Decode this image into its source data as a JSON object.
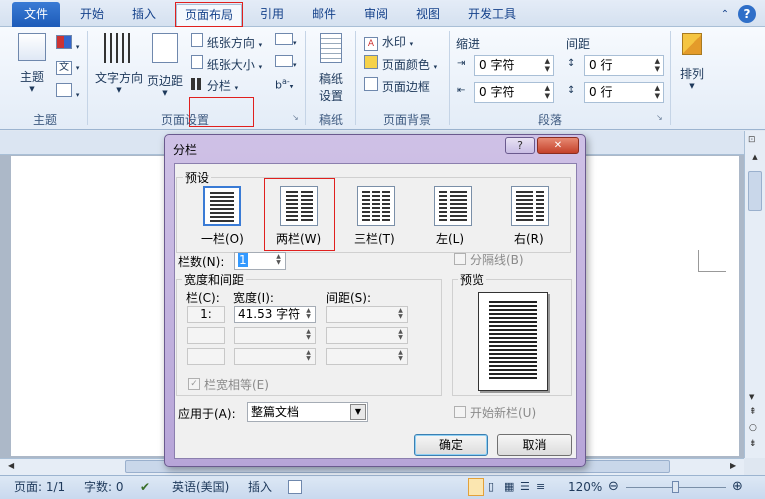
{
  "tabs": [
    "文件",
    "开始",
    "插入",
    "页面布局",
    "引用",
    "邮件",
    "审阅",
    "视图",
    "开发工具"
  ],
  "ribbon": {
    "theme_group": {
      "label": "主题",
      "theme_btn": "主题"
    },
    "page_setup_group": {
      "label": "页面设置",
      "text_direction": "文字方向",
      "margins": "页边距",
      "orientation": "纸张方向",
      "size": "纸张大小",
      "columns": "分栏"
    },
    "draft_group": {
      "label": "稿纸",
      "draft_btn_line1": "稿纸",
      "draft_btn_line2": "设置"
    },
    "background_group": {
      "label": "页面背景",
      "watermark": "水印",
      "page_color": "页面颜色",
      "page_borders": "页面边框"
    },
    "paragraph_group": {
      "label": "段落",
      "indent_label": "缩进",
      "spacing_label": "间距",
      "indent_left": "0 字符",
      "indent_right": "0 字符",
      "spacing_before": "0 行",
      "spacing_after": "0 行"
    },
    "arrange_group": {
      "label": "排列"
    }
  },
  "dialog": {
    "title": "分栏",
    "help": "?",
    "close": "✕",
    "preset_label": "预设",
    "presets": [
      "一栏(O)",
      "两栏(W)",
      "三栏(T)",
      "左(L)",
      "右(R)"
    ],
    "num_columns_label": "栏数(N):",
    "num_columns": "1",
    "line_between": "分隔线(B)",
    "width_spacing_label": "宽度和间距",
    "col_header": "栏(C):",
    "width_header": "宽度(I):",
    "spacing_header": "间距(S):",
    "col1_num": "1:",
    "col1_width": "41.53 字符",
    "equal_width": "栏宽相等(E)",
    "preview_label": "预览",
    "apply_to_label": "应用于(A):",
    "apply_to_value": "整篇文档",
    "new_column": "开始新栏(U)",
    "ok": "确定",
    "cancel": "取消"
  },
  "status": {
    "page": "页面: 1/1",
    "words": "字数: 0",
    "language": "英语(美国)",
    "mode": "插入",
    "zoom": "120%"
  }
}
